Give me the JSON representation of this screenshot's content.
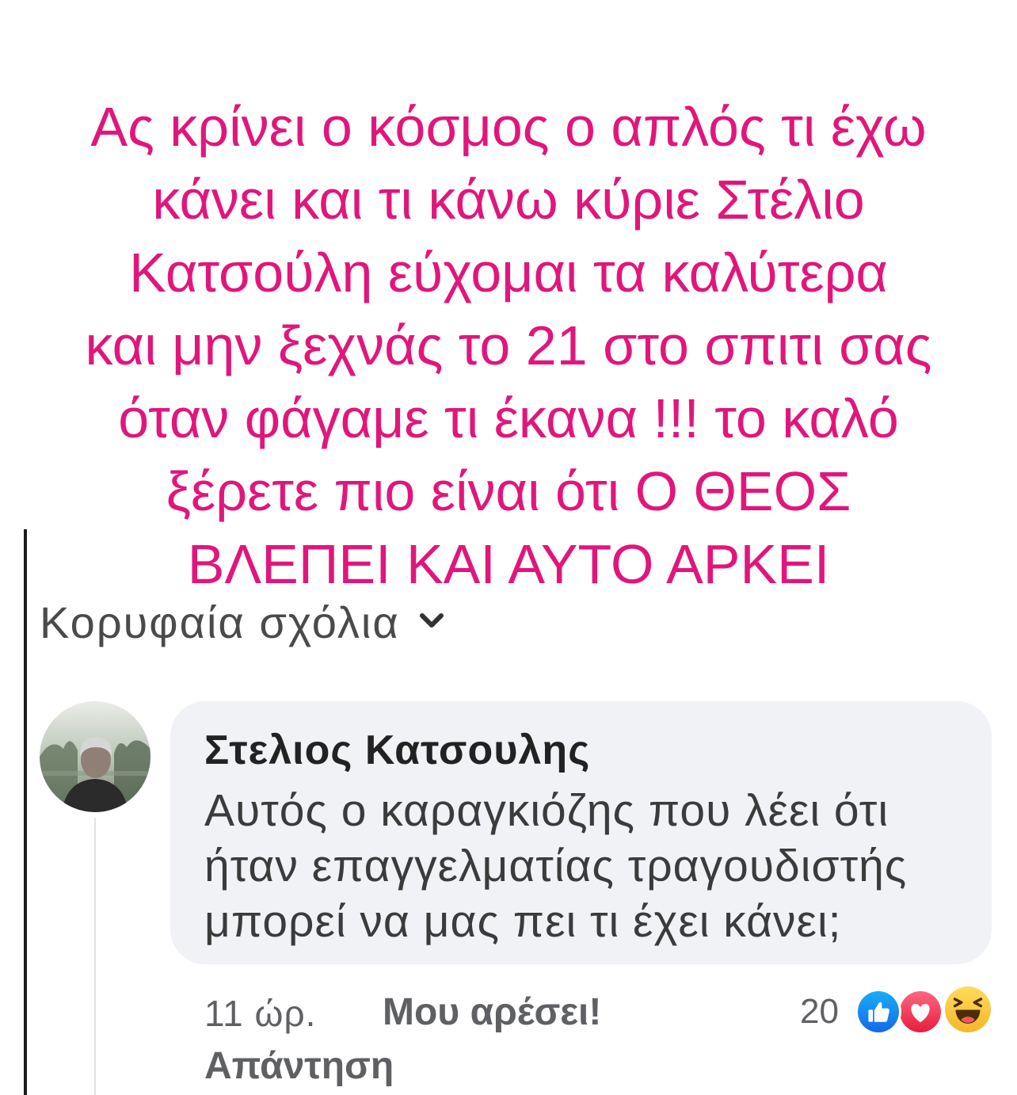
{
  "story_caption": {
    "lines": [
      "Ας κρίνει ο κόσμος ο απλός τι έχω",
      "κάνει και τι κάνω κύριε Στέλιο",
      "Κατσούλη εύχομαι τα καλύτερα",
      "και μην ξεχνάς το 21 στο σπιτι σας",
      "όταν φάγαμε τι έκανα !!! το καλό",
      "ξέρετε πιο είναι ότι Ο ΘΕΟΣ",
      "ΒΛΕΠΕΙ ΚΑΙ ΑΥΤΟ ΑΡΚΕΙ"
    ]
  },
  "comments": {
    "sort_label": "Κορυφαία σχόλια",
    "sort_icon": "chevron-down-icon",
    "items": [
      {
        "avatar_icon": "avatar",
        "author": "Στελιος Κατσουλης",
        "text_lines": [
          "Αυτός ο καραγκιόζης που λέει ότι",
          "ήταν επαγγελματίας τραγουδιστής",
          "μπορεί να μας πει τι έχει κάνει;"
        ],
        "time": "11 ώρ.",
        "like_label": "Μου αρέσει!",
        "reply_label": "Απάντηση",
        "reaction_count": "20",
        "reactions": [
          "like-icon",
          "love-icon",
          "haha-icon"
        ]
      }
    ]
  },
  "colors": {
    "caption_pink": "#e1167b",
    "bubble_background": "#f0f2f5",
    "meta_text": "#5f6064",
    "like_blue": "#1877f2",
    "love_red": "#f33e58",
    "haha_yellow": "#fcc63a"
  }
}
